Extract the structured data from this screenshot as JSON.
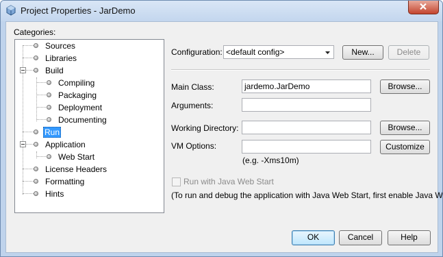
{
  "window": {
    "title": "Project Properties - JarDemo"
  },
  "categories": {
    "label": "Categories:",
    "items": [
      {
        "label": "Sources"
      },
      {
        "label": "Libraries"
      },
      {
        "label": "Build"
      },
      {
        "label": "Compiling"
      },
      {
        "label": "Packaging"
      },
      {
        "label": "Deployment"
      },
      {
        "label": "Documenting"
      },
      {
        "label": "Run",
        "selected": true
      },
      {
        "label": "Application"
      },
      {
        "label": "Web Start"
      },
      {
        "label": "License Headers"
      },
      {
        "label": "Formatting"
      },
      {
        "label": "Hints"
      }
    ]
  },
  "configuration": {
    "label": "Configuration:",
    "selected": "<default config>",
    "new_label": "New...",
    "delete_label": "Delete"
  },
  "form": {
    "main_class_label": "Main Class:",
    "main_class_value": "jardemo.JarDemo",
    "browse_label": "Browse...",
    "arguments_label": "Arguments:",
    "arguments_value": "",
    "working_dir_label": "Working Directory:",
    "working_dir_value": "",
    "working_dir_browse_label": "Browse...",
    "vm_options_label": "VM Options:",
    "vm_options_value": "",
    "customize_label": "Customize",
    "vm_hint": "(e.g. -Xms10m)",
    "webstart_label": "Run with Java Web Start",
    "webstart_checked": false,
    "webstart_note": "(To run and debug the application with Java Web Start, first enable Java Web"
  },
  "footer": {
    "ok_label": "OK",
    "cancel_label": "Cancel",
    "help_label": "Help"
  },
  "colors": {
    "selection": "#3399ff",
    "title_bar": "#c3d6ee",
    "close_button": "#c4452f"
  }
}
